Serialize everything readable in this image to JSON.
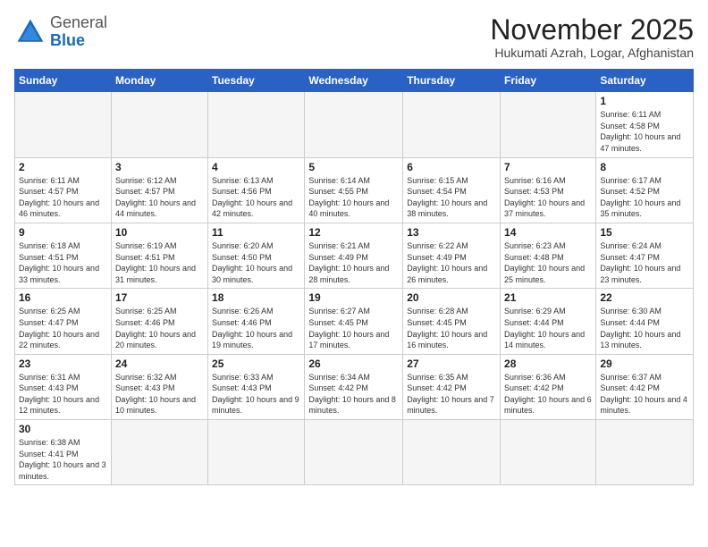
{
  "logo": {
    "general": "General",
    "blue": "Blue"
  },
  "header": {
    "month_title": "November 2025",
    "subtitle": "Hukumati Azrah, Logar, Afghanistan"
  },
  "weekdays": [
    "Sunday",
    "Monday",
    "Tuesday",
    "Wednesday",
    "Thursday",
    "Friday",
    "Saturday"
  ],
  "days": {
    "1": {
      "sunrise": "6:11 AM",
      "sunset": "4:58 PM",
      "daylight": "10 hours and 47 minutes."
    },
    "2": {
      "sunrise": "6:11 AM",
      "sunset": "4:57 PM",
      "daylight": "10 hours and 46 minutes."
    },
    "3": {
      "sunrise": "6:12 AM",
      "sunset": "4:57 PM",
      "daylight": "10 hours and 44 minutes."
    },
    "4": {
      "sunrise": "6:13 AM",
      "sunset": "4:56 PM",
      "daylight": "10 hours and 42 minutes."
    },
    "5": {
      "sunrise": "6:14 AM",
      "sunset": "4:55 PM",
      "daylight": "10 hours and 40 minutes."
    },
    "6": {
      "sunrise": "6:15 AM",
      "sunset": "4:54 PM",
      "daylight": "10 hours and 38 minutes."
    },
    "7": {
      "sunrise": "6:16 AM",
      "sunset": "4:53 PM",
      "daylight": "10 hours and 37 minutes."
    },
    "8": {
      "sunrise": "6:17 AM",
      "sunset": "4:52 PM",
      "daylight": "10 hours and 35 minutes."
    },
    "9": {
      "sunrise": "6:18 AM",
      "sunset": "4:51 PM",
      "daylight": "10 hours and 33 minutes."
    },
    "10": {
      "sunrise": "6:19 AM",
      "sunset": "4:51 PM",
      "daylight": "10 hours and 31 minutes."
    },
    "11": {
      "sunrise": "6:20 AM",
      "sunset": "4:50 PM",
      "daylight": "10 hours and 30 minutes."
    },
    "12": {
      "sunrise": "6:21 AM",
      "sunset": "4:49 PM",
      "daylight": "10 hours and 28 minutes."
    },
    "13": {
      "sunrise": "6:22 AM",
      "sunset": "4:49 PM",
      "daylight": "10 hours and 26 minutes."
    },
    "14": {
      "sunrise": "6:23 AM",
      "sunset": "4:48 PM",
      "daylight": "10 hours and 25 minutes."
    },
    "15": {
      "sunrise": "6:24 AM",
      "sunset": "4:47 PM",
      "daylight": "10 hours and 23 minutes."
    },
    "16": {
      "sunrise": "6:25 AM",
      "sunset": "4:47 PM",
      "daylight": "10 hours and 22 minutes."
    },
    "17": {
      "sunrise": "6:25 AM",
      "sunset": "4:46 PM",
      "daylight": "10 hours and 20 minutes."
    },
    "18": {
      "sunrise": "6:26 AM",
      "sunset": "4:46 PM",
      "daylight": "10 hours and 19 minutes."
    },
    "19": {
      "sunrise": "6:27 AM",
      "sunset": "4:45 PM",
      "daylight": "10 hours and 17 minutes."
    },
    "20": {
      "sunrise": "6:28 AM",
      "sunset": "4:45 PM",
      "daylight": "10 hours and 16 minutes."
    },
    "21": {
      "sunrise": "6:29 AM",
      "sunset": "4:44 PM",
      "daylight": "10 hours and 14 minutes."
    },
    "22": {
      "sunrise": "6:30 AM",
      "sunset": "4:44 PM",
      "daylight": "10 hours and 13 minutes."
    },
    "23": {
      "sunrise": "6:31 AM",
      "sunset": "4:43 PM",
      "daylight": "10 hours and 12 minutes."
    },
    "24": {
      "sunrise": "6:32 AM",
      "sunset": "4:43 PM",
      "daylight": "10 hours and 10 minutes."
    },
    "25": {
      "sunrise": "6:33 AM",
      "sunset": "4:43 PM",
      "daylight": "10 hours and 9 minutes."
    },
    "26": {
      "sunrise": "6:34 AM",
      "sunset": "4:42 PM",
      "daylight": "10 hours and 8 minutes."
    },
    "27": {
      "sunrise": "6:35 AM",
      "sunset": "4:42 PM",
      "daylight": "10 hours and 7 minutes."
    },
    "28": {
      "sunrise": "6:36 AM",
      "sunset": "4:42 PM",
      "daylight": "10 hours and 6 minutes."
    },
    "29": {
      "sunrise": "6:37 AM",
      "sunset": "4:42 PM",
      "daylight": "10 hours and 4 minutes."
    },
    "30": {
      "sunrise": "6:38 AM",
      "sunset": "4:41 PM",
      "daylight": "10 hours and 3 minutes."
    }
  }
}
